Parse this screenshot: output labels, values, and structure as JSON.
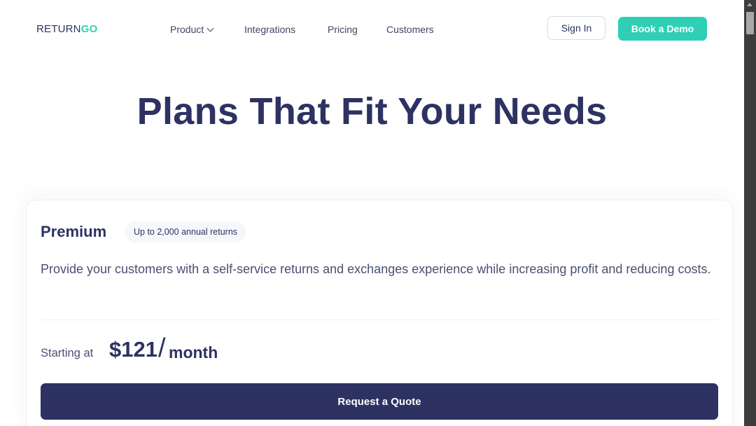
{
  "header": {
    "logo_part1": "RETURN",
    "logo_part2": "GO",
    "nav": [
      {
        "label": "Product",
        "has_dropdown": true
      },
      {
        "label": "Integrations"
      },
      {
        "label": "Pricing"
      },
      {
        "label": "Customers"
      }
    ],
    "signin_label": "Sign In",
    "demo_label": "Book a Demo"
  },
  "hero": {
    "title": "Plans That Fit Your Needs"
  },
  "plan": {
    "name": "Premium",
    "badge": "Up to 2,000 annual returns",
    "description": "Provide your customers with a self-service returns and exchanges experience while increasing profit and reducing costs.",
    "starting_label": "Starting at",
    "price": "$121",
    "slash": "/",
    "period": "month",
    "cta_label": "Request a Quote"
  },
  "colors": {
    "brand_navy": "#2d3262",
    "accent_teal": "#2fcfb5"
  },
  "icons": {
    "product_dropdown": "chevron-down-icon",
    "scroll_up": "scroll-up-arrow-icon"
  }
}
